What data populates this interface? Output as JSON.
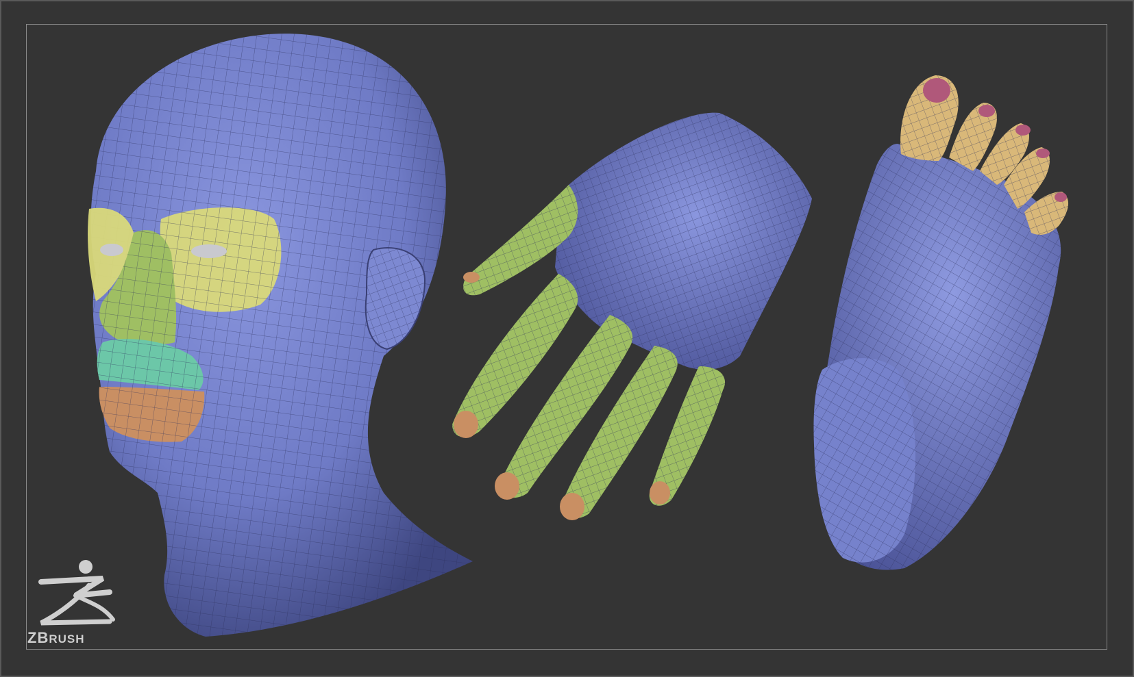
{
  "colors": {
    "background": "#343434",
    "frame_border": "#8a8a8a",
    "base_blue": "#6f7bc6",
    "wire": "#2b2f5a",
    "polygroup_yellow": "#d9d97a",
    "polygroup_green": "#9fbf63",
    "polygroup_teal": "#6cc7a8",
    "polygroup_orange": "#c98f63",
    "polygroup_tan": "#d9b879",
    "polygroup_pink": "#b0587a",
    "logo": "#cfcfcf"
  },
  "models": [
    {
      "name": "head",
      "icon": "head-mesh"
    },
    {
      "name": "hand",
      "icon": "hand-mesh"
    },
    {
      "name": "foot",
      "icon": "foot-mesh"
    }
  ],
  "logo": {
    "icon": "zbrush-logo-icon",
    "text_first": "ZB",
    "text_rest": "RUSH",
    "registered": "®"
  }
}
